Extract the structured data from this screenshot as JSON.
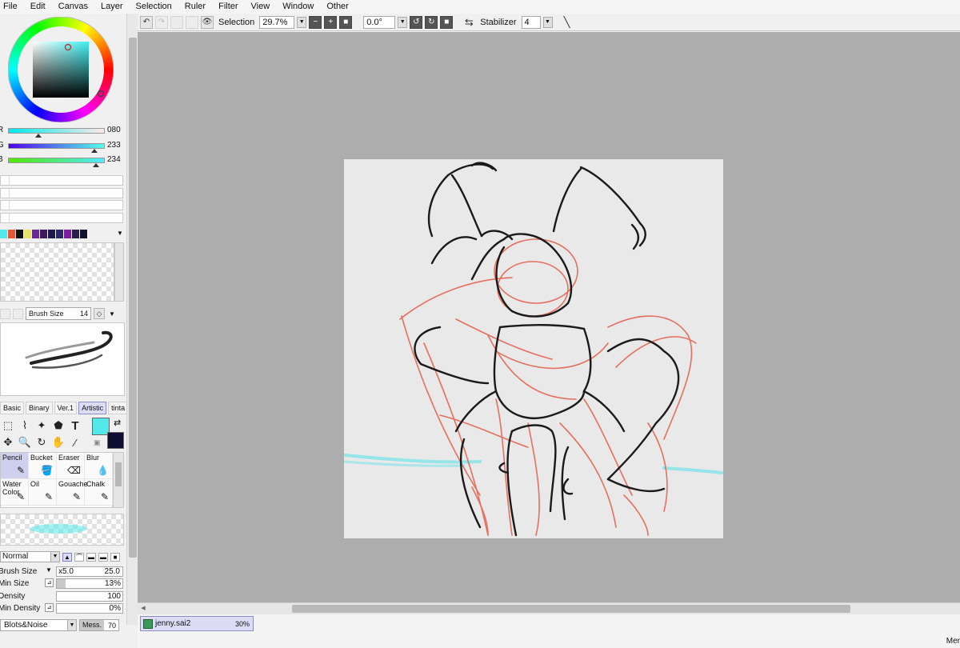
{
  "menu": [
    "File",
    "Edit",
    "Canvas",
    "Layer",
    "Selection",
    "Ruler",
    "Filter",
    "View",
    "Window",
    "Other"
  ],
  "toolbar": {
    "selection_label": "Selection",
    "zoom": "29.7%",
    "rotation": "0.0°",
    "stabilizer_label": "Stabilizer",
    "stabilizer_value": "4"
  },
  "color": {
    "current": "#53E9EA",
    "background": "#0d0d33",
    "r_label": "R",
    "r_value": "080",
    "g_label": "G",
    "g_value": "233",
    "b_label": "B",
    "b_value": "234"
  },
  "swatches": [
    "#53e9ea",
    "#e8543a",
    "#111111",
    "#e7e36a",
    "#6a2896",
    "#3c1a5e",
    "#1a1a4c",
    "#2a2a6a",
    "#7a1ea0",
    "#251f4a",
    "#111133"
  ],
  "brush_size_top": {
    "label": "Brush Size",
    "value": "14"
  },
  "preset_tabs": [
    "Basic",
    "Binary",
    "Ver.1",
    "Artistic",
    "tinta"
  ],
  "active_preset_tab": "Artistic",
  "brushes": [
    {
      "name": "Pencil",
      "active": true
    },
    {
      "name": "Bucket",
      "active": false
    },
    {
      "name": "Eraser",
      "active": false
    },
    {
      "name": "Blur",
      "active": false
    },
    {
      "name": "Water Color",
      "active": false
    },
    {
      "name": "Oil",
      "active": false
    },
    {
      "name": "Gouache",
      "active": false
    },
    {
      "name": "Chalk",
      "active": false
    }
  ],
  "blend_mode": "Normal",
  "params": {
    "brush_size_label": "Brush Size",
    "brush_size_mult": "x5.0",
    "brush_size_value": "25.0",
    "min_size_label": "Min Size",
    "min_size_value": "13%",
    "min_size_frac": 0.13,
    "density_label": "Density",
    "density_value": "100",
    "density_frac": 1.0,
    "min_density_label": "Min Density",
    "min_density_value": "0%",
    "min_density_frac": 0.0
  },
  "noise": {
    "texture": "Blots&Noise",
    "label": "Mess.",
    "value": "70"
  },
  "document": {
    "filename": "jenny.sai2",
    "zoom": "30%"
  },
  "status_right": "Mer"
}
